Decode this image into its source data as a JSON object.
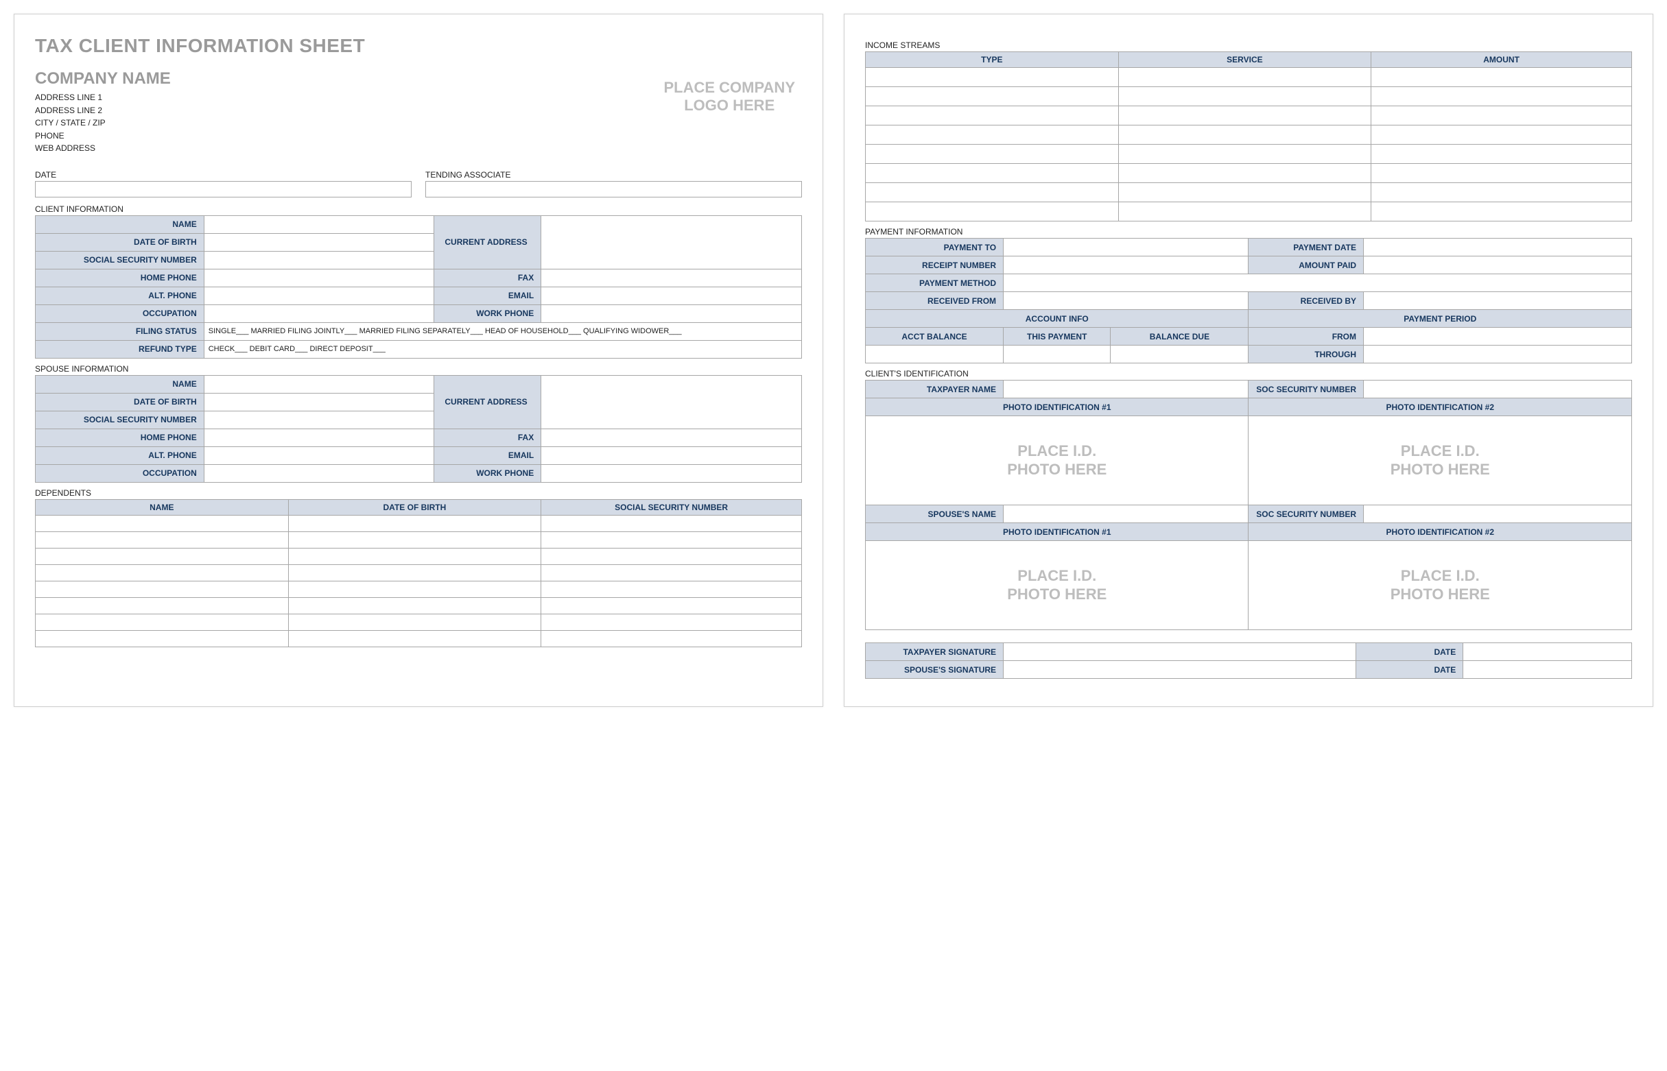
{
  "doc_title": "TAX CLIENT INFORMATION SHEET",
  "company": {
    "name": "COMPANY NAME",
    "addr1": "ADDRESS LINE 1",
    "addr2": "ADDRESS LINE 2",
    "csz": "CITY / STATE / ZIP",
    "phone": "PHONE",
    "web": "WEB ADDRESS"
  },
  "logo_placeholder": "PLACE COMPANY\nLOGO HERE",
  "date_label": "DATE",
  "tending_label": "TENDING ASSOCIATE",
  "sections": {
    "client_info": "CLIENT INFORMATION",
    "spouse_info": "SPOUSE INFORMATION",
    "dependents": "DEPENDENTS",
    "income": "INCOME STREAMS",
    "payment": "PAYMENT INFORMATION",
    "client_id": "CLIENT'S IDENTIFICATION"
  },
  "labels": {
    "name": "NAME",
    "dob": "DATE OF BIRTH",
    "ssn": "SOCIAL SECURITY NUMBER",
    "home_phone": "HOME PHONE",
    "alt_phone": "ALT. PHONE",
    "occupation": "OCCUPATION",
    "filing_status": "FILING STATUS",
    "refund_type": "REFUND TYPE",
    "current_address": "CURRENT ADDRESS",
    "fax": "FAX",
    "email": "EMAIL",
    "work_phone": "WORK PHONE",
    "type": "TYPE",
    "service": "SERVICE",
    "amount": "AMOUNT",
    "payment_to": "PAYMENT TO",
    "payment_date": "PAYMENT DATE",
    "receipt_number": "RECEIPT NUMBER",
    "amount_paid": "AMOUNT PAID",
    "payment_method": "PAYMENT METHOD",
    "received_from": "RECEIVED FROM",
    "received_by": "RECEIVED BY",
    "account_info": "ACCOUNT INFO",
    "payment_period": "PAYMENT PERIOD",
    "acct_balance": "ACCT BALANCE",
    "this_payment": "THIS PAYMENT",
    "balance_due": "BALANCE DUE",
    "from": "FROM",
    "through": "THROUGH",
    "taxpayer_name": "TAXPAYER NAME",
    "soc_sec_number": "SOC SECURITY NUMBER",
    "photo_id_1": "PHOTO IDENTIFICATION #1",
    "photo_id_2": "PHOTO IDENTIFICATION #2",
    "spouses_name": "SPOUSE'S NAME",
    "taxpayer_signature": "TAXPAYER SIGNATURE",
    "spouses_signature": "SPOUSE'S SIGNATURE",
    "date": "DATE",
    "dep_name": "NAME",
    "dep_dob": "DATE OF BIRTH",
    "dep_ssn": "SOCIAL SECURITY NUMBER"
  },
  "filing_text": "SINGLE___   MARRIED FILING JOINTLY___   MARRIED FILING SEPARATELY___   HEAD OF HOUSEHOLD___   QUALIFYING WIDOWER___",
  "refund_text": "CHECK___   DEBIT CARD___   DIRECT DEPOSIT___",
  "photo_placeholder": "PLACE I.D.\nPHOTO HERE"
}
